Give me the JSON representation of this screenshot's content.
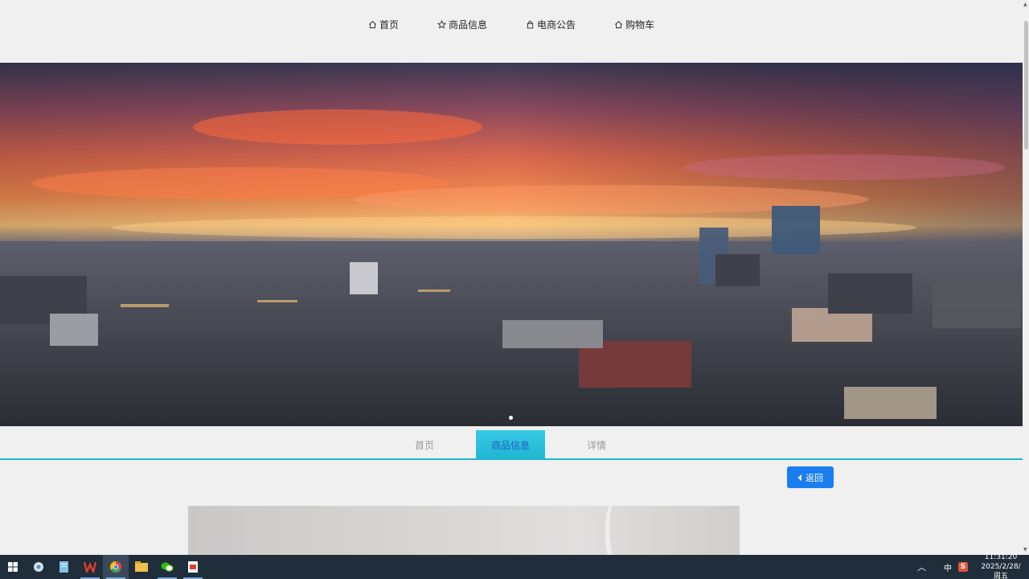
{
  "nav": {
    "items": [
      {
        "label": "首页",
        "icon": "home-icon"
      },
      {
        "label": "商品信息",
        "icon": "star-icon"
      },
      {
        "label": "电商公告",
        "icon": "bag-icon"
      },
      {
        "label": "购物车",
        "icon": "home-icon"
      }
    ]
  },
  "tabs": [
    {
      "label": "首页"
    },
    {
      "label": "商品信息"
    },
    {
      "label": "详情"
    }
  ],
  "back_button": {
    "label": "返回",
    "icon": "caret-left-icon"
  },
  "taskbar": {
    "apps": [
      "windows-start-icon",
      "settings-icon",
      "notepad-icon",
      "wps-icon",
      "chrome-icon",
      "file-explorer-icon",
      "wechat-icon",
      "office-doc-icon"
    ],
    "ime": "中",
    "time": "11:31:20",
    "date": "2025/2/28/周五"
  },
  "colors": {
    "accent": "#1fb5d0",
    "button": "#1a7ef0",
    "taskbar": "#202d3a"
  }
}
